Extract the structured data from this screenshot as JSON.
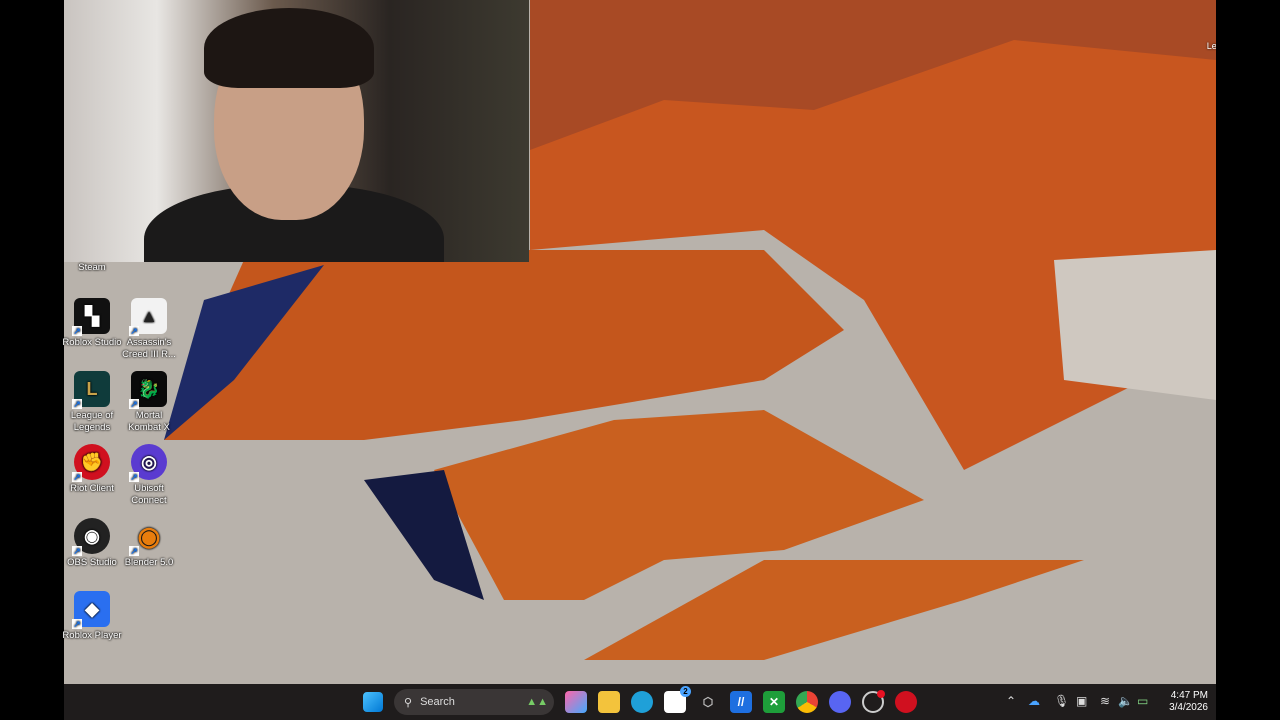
{
  "desktop": {
    "learn_about_picture": "Learn about this picture",
    "steam_label": "Steam",
    "icons": [
      {
        "label": "Roblox Studio",
        "color": "#111111",
        "glyph": "▚"
      },
      {
        "label": "Assassin's Creed III R...",
        "color": "#f2f2f2",
        "glyph": "▲"
      },
      {
        "label": "League of Legends",
        "color": "#0f3b3b",
        "glyph": "L"
      },
      {
        "label": "Mortal Kombat X",
        "color": "#0a0a0a",
        "glyph": "🐉"
      },
      {
        "label": "Riot Client",
        "color": "#d0101f",
        "glyph": "✊"
      },
      {
        "label": "Ubisoft Connect",
        "color": "#5a3bd0",
        "glyph": "◎"
      },
      {
        "label": "OBS Studio",
        "color": "#222222",
        "glyph": "◉"
      },
      {
        "label": "Blender 5.0",
        "color": "#e87d0d",
        "glyph": "◉"
      },
      {
        "label": "Roblox Player",
        "color": "#2a6ff0",
        "glyph": "◆"
      }
    ]
  },
  "taskbar": {
    "search_placeholder": "Search",
    "store_badge": "2",
    "apps": [
      "start",
      "copilot",
      "file-explorer",
      "edge",
      "microsoft-store",
      "unknown-app",
      "teamviewer",
      "xbox",
      "chrome",
      "discord",
      "obs-studio",
      "riot-client"
    ],
    "clock": {
      "time": "4:47 PM",
      "date": "3/4/2026"
    }
  }
}
